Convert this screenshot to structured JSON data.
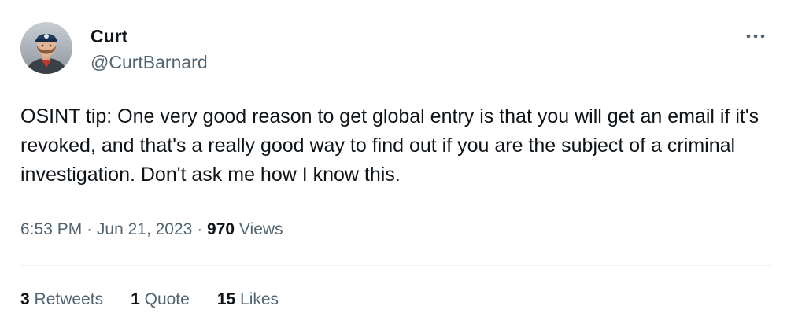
{
  "author": {
    "display_name": "Curt",
    "handle": "@CurtBarnard",
    "avatar_icon": "profile-photo"
  },
  "more_icon": "more-horizontal-icon",
  "tweet": {
    "text": "OSINT tip: One very good reason to get global entry is that you will get an email if it's revoked, and that's a really good way to find out if you are the subject of a criminal investigation. Don't ask me how I know this."
  },
  "meta": {
    "time": "6:53 PM",
    "sep1": "·",
    "date": "Jun 21, 2023",
    "sep2": "·",
    "views_count": "970",
    "views_label": "Views"
  },
  "stats": {
    "retweets_count": "3",
    "retweets_label": "Retweets",
    "quotes_count": "1",
    "quotes_label": "Quote",
    "likes_count": "15",
    "likes_label": "Likes"
  },
  "colors": {
    "text_primary": "#0f1419",
    "text_secondary": "#536471",
    "divider": "#eff3f4",
    "background": "#ffffff"
  }
}
